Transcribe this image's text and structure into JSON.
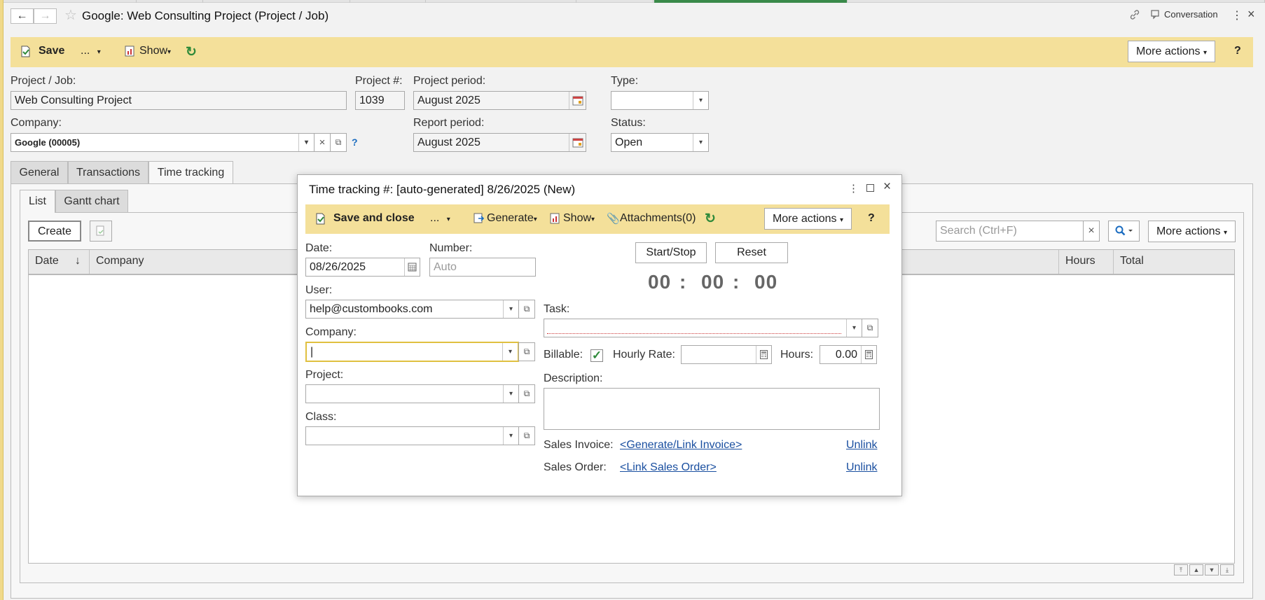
{
  "window": {
    "title": "Google: Web Consulting Project (Project / Job)",
    "conversation_label": "Conversation",
    "back_icon": "arrow-left-icon",
    "forward_icon": "arrow-right-icon"
  },
  "toolbar": {
    "save_label": "Save",
    "more_label": "...",
    "show_label": "Show",
    "more_actions_label": "More actions",
    "help_label": "?"
  },
  "form": {
    "project_label": "Project / Job:",
    "project_value": "Web Consulting Project",
    "project_num_label": "Project #:",
    "project_num_value": "1039",
    "project_period_label": "Project period:",
    "project_period_value": "August 2025",
    "type_label": "Type:",
    "type_value": "",
    "company_label": "Company:",
    "company_value": "Google (00005)",
    "company_help": "?",
    "report_period_label": "Report period:",
    "report_period_value": "August 2025",
    "status_label": "Status:",
    "status_value": "Open"
  },
  "tabs": [
    {
      "label": "General"
    },
    {
      "label": "Transactions"
    },
    {
      "label": "Time tracking"
    }
  ],
  "subtabs": [
    {
      "label": "List"
    },
    {
      "label": "Gantt chart"
    }
  ],
  "list": {
    "create_label": "Create",
    "search_placeholder": "Search (Ctrl+F)",
    "more_actions_label": "More actions",
    "columns": [
      "Date",
      "Company",
      "Hours",
      "Total"
    ],
    "sort_indicator": "↓"
  },
  "dialog": {
    "title": "Time tracking #: [auto-generated] 8/26/2025 (New)",
    "save_close_label": "Save and close",
    "more_label": "...",
    "generate_label": "Generate",
    "show_label": "Show",
    "attachments_label": "Attachments(0)",
    "more_actions_label": "More actions",
    "help_label": "?",
    "date_label": "Date:",
    "date_value": "08/26/2025",
    "number_label": "Number:",
    "number_placeholder": "Auto",
    "user_label": "User:",
    "user_value": "help@custombooks.com",
    "company_label": "Company:",
    "company_value": "|",
    "project_label": "Project:",
    "project_value": "",
    "class_label": "Class:",
    "class_value": "",
    "start_stop_label": "Start/Stop",
    "reset_label": "Reset",
    "timer_hours": "00",
    "timer_minutes": "00",
    "timer_seconds": "00",
    "timer_sep": ":",
    "task_label": "Task:",
    "task_value": "",
    "billable_label": "Billable:",
    "billable_checked": "✓",
    "hourly_rate_label": "Hourly Rate:",
    "hourly_rate_value": "",
    "hours_label": "Hours:",
    "hours_value": "0.00",
    "description_label": "Description:",
    "sales_invoice_label": "Sales Invoice:",
    "sales_invoice_link": "<Generate/Link Invoice>",
    "sales_order_label": "Sales Order:",
    "sales_order_link": "<Link Sales Order>",
    "unlink_label": "Unlink"
  },
  "colors": {
    "toolbar": "#f4e09a",
    "accent_green": "#2f8a3a",
    "link": "#1a4fa0"
  }
}
